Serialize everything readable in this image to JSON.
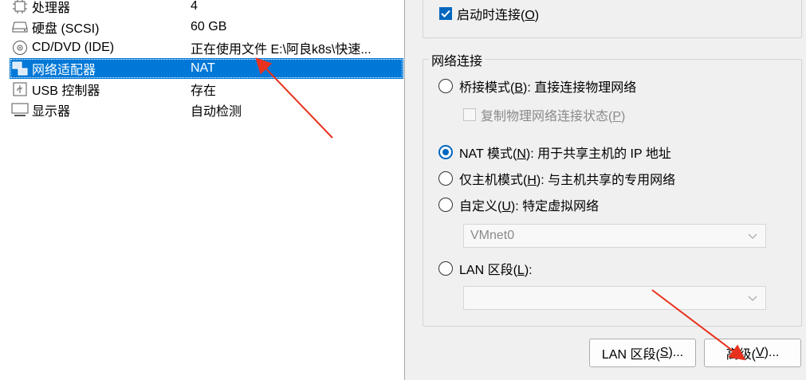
{
  "devices": [
    {
      "name": "处理器",
      "summary": "4",
      "icon": "processor-icon"
    },
    {
      "name": "硬盘 (SCSI)",
      "summary": "60 GB",
      "icon": "hard-disk-icon"
    },
    {
      "name": "CD/DVD (IDE)",
      "summary": "正在使用文件 E:\\阿良k8s\\快速...",
      "icon": "cd-dvd-icon"
    },
    {
      "name": "网络适配器",
      "summary": "NAT",
      "icon": "network-adapter-icon",
      "selected": true
    },
    {
      "name": "USB 控制器",
      "summary": "存在",
      "icon": "usb-icon"
    },
    {
      "name": "显示器",
      "summary": "自动检测",
      "icon": "monitor-icon"
    }
  ],
  "device_status": {
    "connect_on_startup_label": "启动时连接(",
    "connect_on_startup_key": "O",
    "connect_on_startup_end": ")",
    "connect_on_startup_checked": true
  },
  "network": {
    "title": "网络连接",
    "bridged": {
      "pre": "桥接模式(",
      "key": "B",
      "post": "): 直接连接物理网络"
    },
    "replicate": {
      "pre": "复制物理网络连接状态(",
      "key": "P",
      "post": ")"
    },
    "nat": {
      "pre": "NAT 模式(",
      "key": "N",
      "post": "): 用于共享主机的 IP 地址"
    },
    "hostonly": {
      "pre": "仅主机模式(",
      "key": "H",
      "post": "): 与主机共享的专用网络"
    },
    "custom": {
      "pre": "自定义(",
      "key": "U",
      "post": "): 特定虚拟网络"
    },
    "custom_value": "VMnet0",
    "lan": {
      "pre": "LAN 区段(",
      "key": "L",
      "post": "):"
    },
    "lan_value": "",
    "selected_mode": "nat"
  },
  "buttons": {
    "lan_segments": {
      "pre": "LAN 区段(",
      "key": "S",
      "post": ")..."
    },
    "advanced": {
      "pre": "高级(",
      "key": "V",
      "post": ")..."
    }
  },
  "colors": {
    "selection": "#0078d7",
    "accent": "#0067c0",
    "annotation_arrow": "#e8321e"
  }
}
